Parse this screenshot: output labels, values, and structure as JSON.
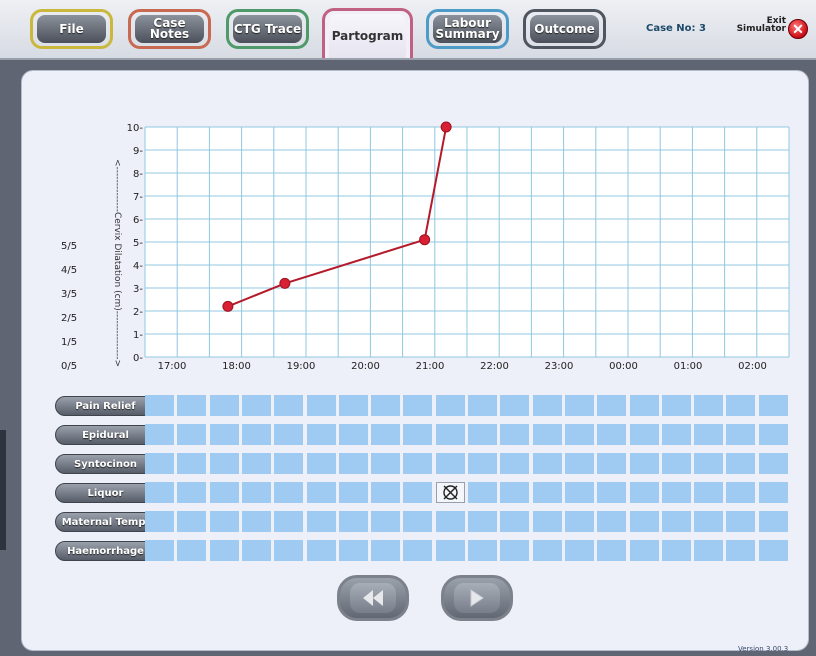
{
  "tabs": [
    {
      "label": "File"
    },
    {
      "label": "Case\nNotes"
    },
    {
      "label": "CTG Trace"
    },
    {
      "label": "Partogram"
    },
    {
      "label": "Labour\nSummary"
    },
    {
      "label": "Outcome"
    }
  ],
  "case_no": "Case No: 3",
  "exit_label": "Exit\nSimulator",
  "version": "Version 3.00.3",
  "chart_data": {
    "type": "line",
    "ylabel": "<--------------Cervix Dilatation (cm)--------------->",
    "ylim": [
      0,
      10
    ],
    "y_ticks": [
      "0-",
      "1-",
      "2-",
      "3-",
      "4-",
      "5-",
      "6-",
      "7-",
      "8-",
      "9-",
      "10-"
    ],
    "x_ticks": [
      "17:00",
      "18:00",
      "19:00",
      "20:00",
      "21:00",
      "22:00",
      "23:00",
      "00:00",
      "01:00",
      "02:00"
    ],
    "descent_ticks": [
      "0/5",
      "1/5",
      "2/5",
      "3/5",
      "4/5",
      "5/5"
    ],
    "series": [
      {
        "points": [
          {
            "x": "17:52",
            "y": 2.2
          },
          {
            "x": "18:45",
            "y": 3.2
          },
          {
            "x": "20:55",
            "y": 5.1
          },
          {
            "x": "21:15",
            "y": 10
          }
        ]
      }
    ],
    "grid": true,
    "line_color": "#b51a2a",
    "grid_color": "#8fc8e0"
  },
  "rows": [
    {
      "label": "Pain Relief"
    },
    {
      "label": "Epidural"
    },
    {
      "label": "Syntocinon"
    },
    {
      "label": "Liquor"
    },
    {
      "label": "Maternal Temp."
    },
    {
      "label": "Haemorrhage"
    }
  ],
  "liquor_marker": {
    "row": "Liquor",
    "cell": 9,
    "icon": "crossed-circle-icon"
  },
  "nav": {
    "prev_icon": "double-chevron-left-icon",
    "next_icon": "chevron-right-icon"
  }
}
